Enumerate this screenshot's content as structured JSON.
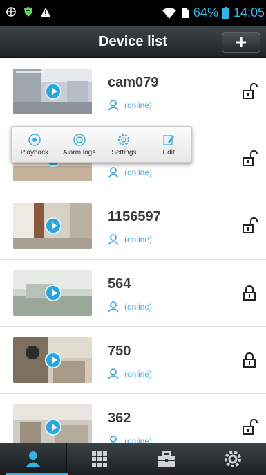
{
  "status_bar": {
    "battery": "64%",
    "time": "14:05"
  },
  "header": {
    "title": "Device list",
    "add_label": "+"
  },
  "popup_menu": [
    {
      "label": "Playback",
      "icon": "playback-icon"
    },
    {
      "label": "Alarm logs",
      "icon": "alarm-logs-icon"
    },
    {
      "label": "Settings",
      "icon": "gear-icon"
    },
    {
      "label": "Edit",
      "icon": "edit-icon"
    }
  ],
  "devices": [
    {
      "name": "cam079",
      "status": "(online)",
      "locked": false
    },
    {
      "name": "",
      "status": "(online)",
      "locked": false
    },
    {
      "name": "1156597",
      "status": "(online)",
      "locked": false
    },
    {
      "name": "564",
      "status": "(online)",
      "locked": true
    },
    {
      "name": "750",
      "status": "(online)",
      "locked": true
    },
    {
      "name": "362",
      "status": "(online)",
      "locked": false
    }
  ],
  "bottom_nav": [
    {
      "icon": "user-icon",
      "active": true
    },
    {
      "icon": "grid-icon",
      "active": false
    },
    {
      "icon": "toolbox-icon",
      "active": false
    },
    {
      "icon": "gear-icon",
      "active": false
    }
  ],
  "colors": {
    "accent": "#33b5e5",
    "online": "#4aa9d8",
    "header": "#2a3033"
  }
}
